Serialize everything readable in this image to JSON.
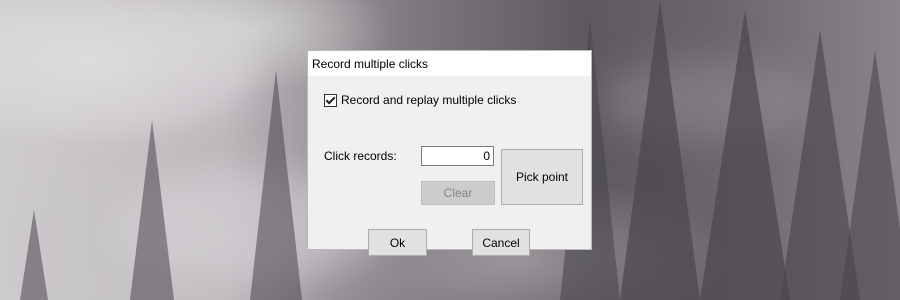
{
  "dialog": {
    "title": "Record multiple clicks",
    "checkbox_label": "Record and replay multiple clicks",
    "checkbox_checked": true,
    "click_records_label": "Click records:",
    "click_records_value": "0",
    "clear_label": "Clear",
    "pick_point_label": "Pick point",
    "ok_label": "Ok",
    "cancel_label": "Cancel"
  }
}
